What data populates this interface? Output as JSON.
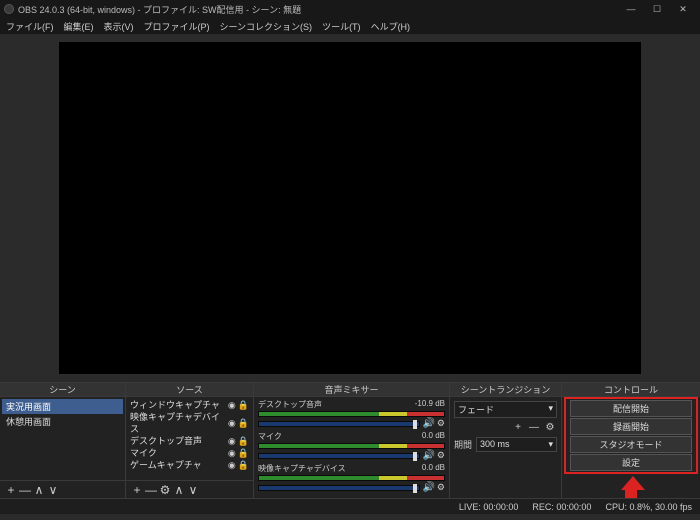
{
  "title": "OBS 24.0.3 (64-bit, windows) - プロファイル: SW配信用 - シーン: 無題",
  "menu": [
    "ファイル(F)",
    "編集(E)",
    "表示(V)",
    "プロファイル(P)",
    "シーンコレクション(S)",
    "ツール(T)",
    "ヘルプ(H)"
  ],
  "panels": {
    "scenes": {
      "title": "シーン",
      "items": [
        "実況用画面",
        "休憩用画面"
      ],
      "selected": 0
    },
    "sources": {
      "title": "ソース",
      "items": [
        "ウィンドウキャプチャ",
        "映像キャプチャデバイス",
        "デスクトップ音声",
        "マイク",
        "ゲームキャプチャ"
      ]
    },
    "mixer": {
      "title": "音声ミキサー",
      "channels": [
        {
          "name": "デスクトップ音声",
          "db": "-10.9 dB"
        },
        {
          "name": "マイク",
          "db": "0.0 dB"
        },
        {
          "name": "映像キャプチャデバイス",
          "db": "0.0 dB"
        }
      ]
    },
    "transitions": {
      "title": "シーントランジション",
      "current": "フェード",
      "duration_label": "期間",
      "duration": "300 ms"
    },
    "controls": {
      "title": "コントロール",
      "btns": [
        "配信開始",
        "録画開始",
        "スタジオモード",
        "設定"
      ]
    }
  },
  "status": {
    "live": "LIVE: 00:00:00",
    "rec": "REC: 00:00:00",
    "cpu": "CPU: 0.8%, 30.00 fps"
  },
  "glyph": {
    "min": "—",
    "max": "☐",
    "close": "✕",
    "chev": "▾",
    "plus": "+",
    "minus": "—",
    "up": "∧",
    "down": "∨",
    "gear": "⚙",
    "eye": "◉",
    "lock": "🔒",
    "spk": "🔊"
  }
}
